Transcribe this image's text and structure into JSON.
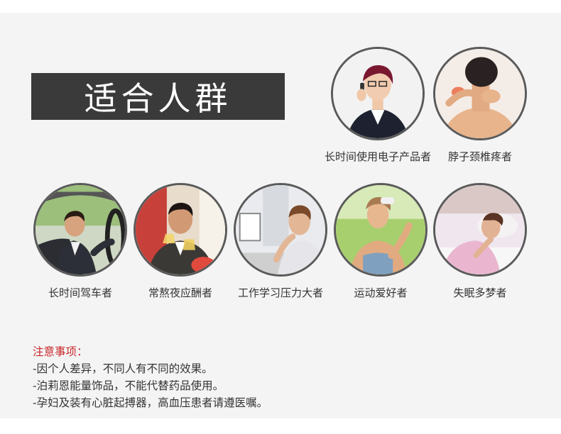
{
  "title": "适合人群",
  "groups": [
    {
      "label": "长时间使用电子产品者",
      "icon": "office-woman-phone-photo"
    },
    {
      "label": "脖子颈椎疼者",
      "icon": "neck-pain-photo"
    },
    {
      "label": "长时间驾车者",
      "icon": "driver-photo"
    },
    {
      "label": "常熬夜应酬者",
      "icon": "social-drinking-photo"
    },
    {
      "label": "工作学习压力大者",
      "icon": "stressed-worker-photo"
    },
    {
      "label": "运动爱好者",
      "icon": "sports-woman-photo"
    },
    {
      "label": "失眠多梦者",
      "icon": "insomnia-photo"
    }
  ],
  "notes": {
    "heading": "注意事项：",
    "items": [
      "-因个人差异，不同人有不同的效果。",
      "-泊莉恩能量饰品，不能代替药品使用。",
      "-孕妇及装有心脏起搏器，高血压患者请遵医嘱。"
    ]
  },
  "colors": {
    "banner_bg": "#3a3a3a",
    "note_heading": "#c9272b",
    "panel_bg": "#f4f4f4"
  }
}
